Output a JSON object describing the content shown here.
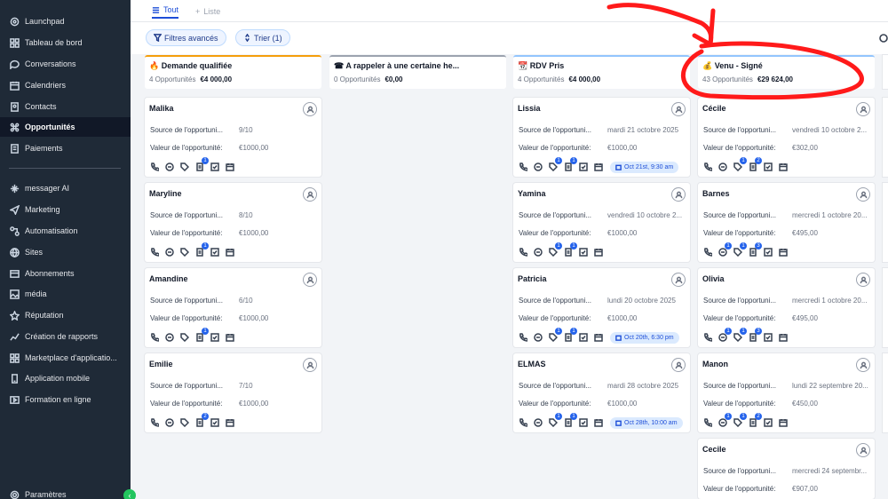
{
  "sidebar": {
    "items": [
      {
        "label": "Launchpad",
        "icon": "rocket-icon"
      },
      {
        "label": "Tableau de bord",
        "icon": "dashboard-icon"
      },
      {
        "label": "Conversations",
        "icon": "chat-icon"
      },
      {
        "label": "Calendriers",
        "icon": "calendar-icon"
      },
      {
        "label": "Contacts",
        "icon": "contacts-icon"
      },
      {
        "label": "Opportunités",
        "icon": "opportunities-icon",
        "active": true
      },
      {
        "label": "Paiements",
        "icon": "payments-icon"
      },
      {
        "label": "messager AI",
        "icon": "sparkle-icon"
      },
      {
        "label": "Marketing",
        "icon": "send-icon"
      },
      {
        "label": "Automatisation",
        "icon": "automation-icon"
      },
      {
        "label": "Sites",
        "icon": "globe-icon"
      },
      {
        "label": "Abonnements",
        "icon": "membership-icon"
      },
      {
        "label": "média",
        "icon": "image-icon"
      },
      {
        "label": "Réputation",
        "icon": "star-icon"
      },
      {
        "label": "Création de rapports",
        "icon": "chart-icon"
      },
      {
        "label": "Marketplace d'applicatio...",
        "icon": "grid-icon"
      },
      {
        "label": "Application mobile",
        "icon": "mobile-icon"
      },
      {
        "label": "Formation en ligne",
        "icon": "video-icon"
      }
    ],
    "settings": "Paramètres"
  },
  "tabs": {
    "all": "Tout",
    "list": "Liste"
  },
  "filters": {
    "advanced": "Filtres avancés",
    "sort": "Trier (1)"
  },
  "columns": [
    {
      "title": "🔥 Demande qualifiée",
      "count": "4 Opportunités",
      "amount": "€4 000,00",
      "cards": [
        {
          "name": "Malika",
          "source_label": "Source de l'opportuni...",
          "source": "9/10",
          "value_label": "Valeur de l'opportunité:",
          "value": "€1000,00",
          "badge": "1"
        },
        {
          "name": "Maryline",
          "source_label": "Source de l'opportuni...",
          "source": "8/10",
          "value_label": "Valeur de l'opportunité:",
          "value": "€1000,00",
          "badge": "1"
        },
        {
          "name": "Amandine",
          "source_label": "Source de l'opportuni...",
          "source": "6/10",
          "value_label": "Valeur de l'opportunité:",
          "value": "€1000,00",
          "badge": "1"
        },
        {
          "name": "Emilie",
          "source_label": "Source de l'opportuni...",
          "source": "7/10",
          "value_label": "Valeur de l'opportunité:",
          "value": "€1000,00",
          "badge": "2"
        }
      ]
    },
    {
      "title": "☎ A rappeler à une certaine he...",
      "count": "0 Opportunités",
      "amount": "€0,00",
      "cards": []
    },
    {
      "title": "📆 RDV Pris",
      "count": "4 Opportunités",
      "amount": "€4 000,00",
      "cards": [
        {
          "name": "Lissia",
          "source_label": "Source de l'opportuni...",
          "source": "mardi 21 octobre 2025",
          "value_label": "Valeur de l'opportunité:",
          "value": "€1000,00",
          "badge1": "1",
          "badge2": "1",
          "appt": "Oct 21st, 9:30 am"
        },
        {
          "name": "Yamina",
          "source_label": "Source de l'opportuni...",
          "source": "vendredi 10 octobre 2...",
          "value_label": "Valeur de l'opportunité:",
          "value": "€1000,00",
          "badge1": "1",
          "badge2": "1"
        },
        {
          "name": "Patricia",
          "source_label": "Source de l'opportuni...",
          "source": "lundi 20 octobre 2025",
          "value_label": "Valeur de l'opportunité:",
          "value": "€1000,00",
          "badge1": "1",
          "badge2": "1",
          "appt": "Oct 20th, 6:30 pm"
        },
        {
          "name": "ELMAS",
          "source_label": "Source de l'opportuni...",
          "source": "mardi 28 octobre 2025",
          "value_label": "Valeur de l'opportunité:",
          "value": "€1000,00",
          "badge1": "1",
          "badge2": "1",
          "appt": "Oct 28th, 10:00 am"
        }
      ]
    },
    {
      "title": "💰 Venu - Signé",
      "count": "43 Opportunités",
      "amount": "€29 624,00",
      "cards": [
        {
          "name": "Cécile",
          "source_label": "Source de l'opportuni...",
          "source": "vendredi 10 octobre 2...",
          "value_label": "Valeur de l'opportunité:",
          "value": "€302,00",
          "badge1": "1",
          "badge2": "2"
        },
        {
          "name": "Barnes",
          "source_label": "Source de l'opportuni...",
          "source": "mercredi 1 octobre 20...",
          "value_label": "Valeur de l'opportunité:",
          "value": "€495,00",
          "badge0": "1",
          "badge1": "1",
          "badge2": "3"
        },
        {
          "name": "Olivia",
          "source_label": "Source de l'opportuni...",
          "source": "mercredi 1 octobre 20...",
          "value_label": "Valeur de l'opportunité:",
          "value": "€495,00",
          "badge0": "1",
          "badge1": "1",
          "badge2": "3"
        },
        {
          "name": "Manon",
          "source_label": "Source de l'opportuni...",
          "source": "lundi 22 septembre 20...",
          "value_label": "Valeur de l'opportunité:",
          "value": "€450,00",
          "badge0": "1",
          "badge1": "1",
          "badge2": "2"
        },
        {
          "name": "Cecile",
          "source_label": "Source de l'opportuni...",
          "source": "mercredi 24 septembr...",
          "value_label": "Valeur de l'opportunité:",
          "value": "€907,00"
        }
      ]
    }
  ],
  "colors": {
    "sidebar": "#1f2a37",
    "accent": "#2563eb",
    "annotation": "#ff1a1a"
  }
}
